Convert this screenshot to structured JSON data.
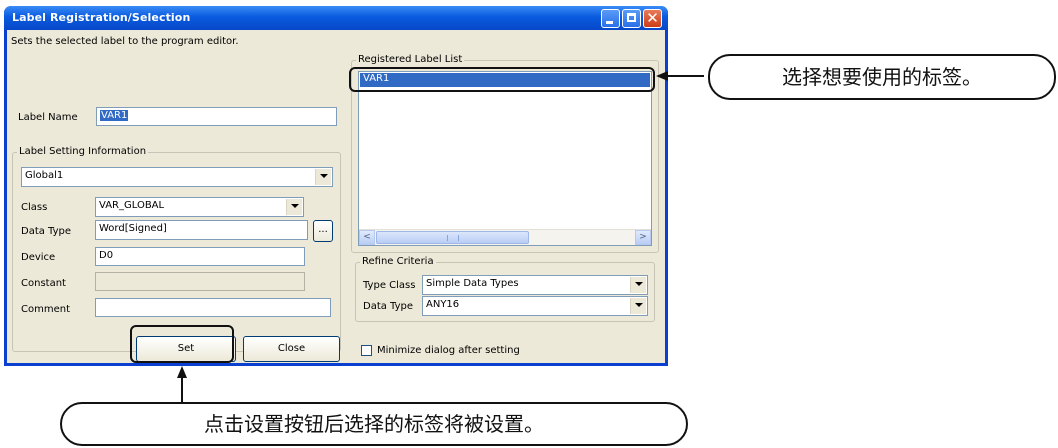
{
  "window": {
    "title": "Label Registration/Selection"
  },
  "instruction": "Sets the selected label to the program editor.",
  "label_name": {
    "label": "Label Name",
    "value": "VAR1"
  },
  "label_setting": {
    "title": "Label Setting Information",
    "scope_value": "Global1",
    "class": {
      "label": "Class",
      "value": "VAR_GLOBAL"
    },
    "data_type": {
      "label": "Data Type",
      "value": "Word[Signed]",
      "browse_label": "..."
    },
    "device": {
      "label": "Device",
      "value": "D0"
    },
    "constant": {
      "label": "Constant",
      "value": ""
    },
    "comment": {
      "label": "Comment",
      "value": ""
    }
  },
  "registered_list": {
    "title": "Registered Label List",
    "items": [
      "VAR1"
    ],
    "selected_index": 0
  },
  "refine": {
    "title": "Refine Criteria",
    "type_class": {
      "label": "Type Class",
      "value": "Simple Data Types"
    },
    "data_type": {
      "label": "Data Type",
      "value": "ANY16"
    }
  },
  "buttons": {
    "set": "Set",
    "close": "Close"
  },
  "minimize_checkbox": {
    "label": "Minimize dialog after setting",
    "checked": false
  },
  "callouts": {
    "right": "选择想要使用的标签。",
    "bottom": "点击设置按钮后选择的标签将被设置。"
  },
  "colors": {
    "title_bar": "#0a5be0",
    "selection": "#316ac5",
    "dialog_bg": "#ece9d8"
  }
}
